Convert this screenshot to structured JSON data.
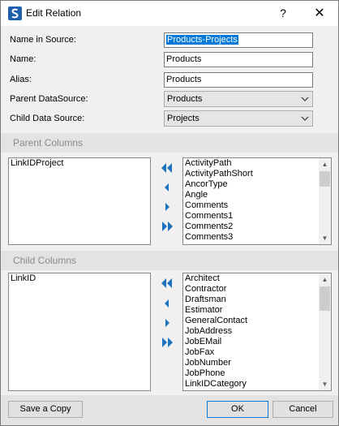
{
  "window": {
    "title": "Edit Relation",
    "help_glyph": "?",
    "close_glyph": "✕"
  },
  "form": {
    "name_in_source_label": "Name in Source:",
    "name_in_source_value": "Products-Projects",
    "name_label": "Name:",
    "name_value": "Products",
    "alias_label": "Alias:",
    "alias_value": "Products",
    "parent_ds_label": "Parent DataSource:",
    "parent_ds_value": "Products",
    "child_ds_label": "Child Data Source:",
    "child_ds_value": "Projects"
  },
  "parent_columns": {
    "title": "Parent Columns",
    "selected": [
      "LinkIDProject"
    ],
    "available": [
      "ActivityPath",
      "ActivityPathShort",
      "AncorType",
      "Angle",
      "Comments",
      "Comments1",
      "Comments2",
      "Comments3"
    ]
  },
  "child_columns": {
    "title": "Child Columns",
    "selected": [
      "LinkID"
    ],
    "available": [
      "Architect",
      "Contractor",
      "Draftsman",
      "Estimator",
      "GeneralContact",
      "JobAddress",
      "JobEMail",
      "JobFax",
      "JobNumber",
      "JobPhone",
      "LinkIDCategory"
    ]
  },
  "icons": {
    "move_all_left": "double-chevron-left-icon",
    "move_left": "chevron-left-icon",
    "move_right": "chevron-right-icon",
    "move_all_right": "double-chevron-right-icon"
  },
  "colors": {
    "accent": "#1e73be",
    "selection": "#0078d7"
  },
  "footer": {
    "save_copy_label": "Save a Copy",
    "ok_label": "OK",
    "cancel_label": "Cancel"
  }
}
